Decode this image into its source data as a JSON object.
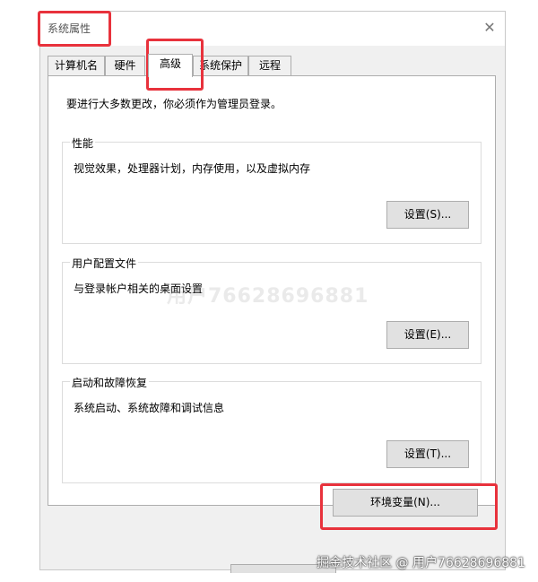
{
  "window": {
    "title": "系统属性",
    "close_symbol": "✕"
  },
  "tabs": [
    {
      "label": "计算机名"
    },
    {
      "label": "硬件"
    },
    {
      "label": "高级",
      "active": true
    },
    {
      "label": "系统保护"
    },
    {
      "label": "远程"
    }
  ],
  "panel": {
    "notice": "要进行大多数更改，你必须作为管理员登录。",
    "groups": [
      {
        "title": "性能",
        "desc": "视觉效果，处理器计划，内存使用，以及虚拟内存",
        "button": "设置(S)..."
      },
      {
        "title": "用户配置文件",
        "desc": "与登录帐户相关的桌面设置",
        "button": "设置(E)..."
      },
      {
        "title": "启动和故障恢复",
        "desc": "系统启动、系统故障和调试信息",
        "button": "设置(T)..."
      }
    ],
    "env_button": "环境变量(N)..."
  },
  "watermark": "用户76628696881",
  "footer_watermark": "掘金技术社区 @ 用户76628696881",
  "colors": {
    "highlight": "#e8323c",
    "window_bg": "#f0f0f0",
    "panel_bg": "#ffffff",
    "button_bg": "#e1e1e1"
  }
}
